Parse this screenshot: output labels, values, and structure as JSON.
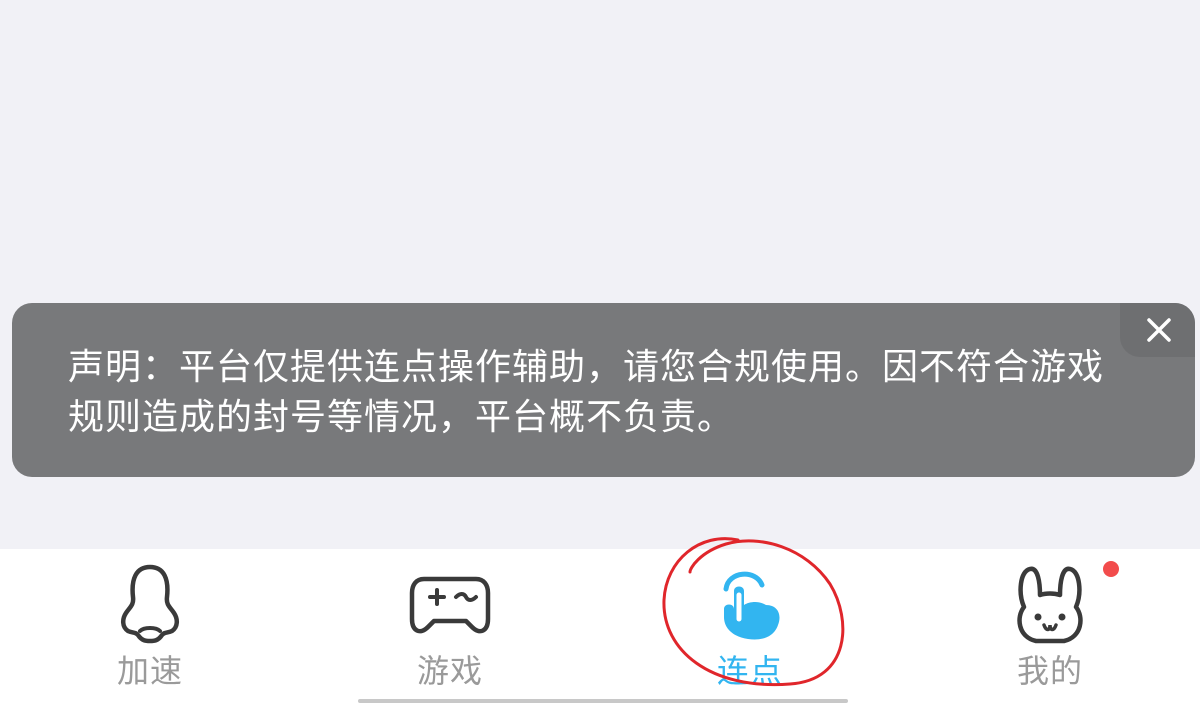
{
  "notice": {
    "text": "声明：平台仅提供连点操作辅助，请您合规使用。因不符合游戏规则造成的封号等情况，平台概不负责。"
  },
  "tabs": [
    {
      "label": "加速",
      "icon": "nose-icon",
      "active": false
    },
    {
      "label": "游戏",
      "icon": "gamepad-icon",
      "active": false
    },
    {
      "label": "连点",
      "icon": "tap-hand-icon",
      "active": true
    },
    {
      "label": "我的",
      "icon": "bunny-icon",
      "active": false,
      "has_badge": true
    }
  ],
  "colors": {
    "active": "#32b5f0",
    "inactive": "#9a9a9a",
    "notice_bg": "#78797b",
    "badge": "#f24c4c",
    "annotation": "#e0262b"
  }
}
